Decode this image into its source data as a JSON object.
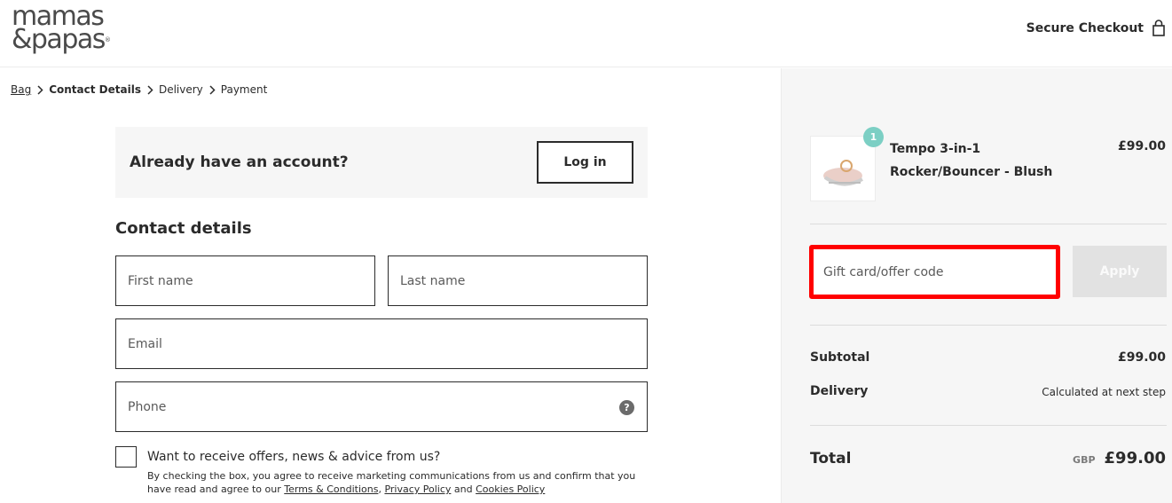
{
  "header": {
    "logo_line1": "mamas",
    "logo_line2": "&papas",
    "logo_mark": "®",
    "secure_checkout": "Secure Checkout",
    "lock_icon": "padlock-icon"
  },
  "breadcrumb": {
    "items": [
      "Bag",
      "Contact Details",
      "Delivery",
      "Payment"
    ],
    "separator_icon": "chevron-right-icon"
  },
  "account": {
    "prompt": "Already have an account?",
    "login_label": "Log in"
  },
  "contact": {
    "title": "Contact details",
    "first_name_placeholder": "First name",
    "last_name_placeholder": "Last name",
    "email_placeholder": "Email",
    "phone_placeholder": "Phone",
    "help_icon": "question-icon",
    "help_glyph": "?",
    "offers_label": "Want to receive offers, news & advice from us?",
    "disclaimer_prefix": "By checking the box, you agree to receive marketing communications from us and confirm that you have read and agree to our ",
    "terms_link": "Terms & Conditions",
    "comma": ", ",
    "privacy_link": "Privacy Policy",
    "and": " and ",
    "cookies_link": "Cookies Policy"
  },
  "summary": {
    "item": {
      "quantity": "1",
      "name": "Tempo 3-in-1 Rocker/Bouncer - Blush",
      "price": "£99.00"
    },
    "gift_placeholder": "Gift card/offer code",
    "apply_label": "Apply",
    "subtotal_label": "Subtotal",
    "subtotal_value": "£99.00",
    "delivery_label": "Delivery",
    "delivery_value": "Calculated at next step",
    "total_label": "Total",
    "currency": "GBP",
    "total_value": "£99.00"
  },
  "colors": {
    "text": "#2b2b2b",
    "summary_bg": "#f6f6f6",
    "quantity_badge": "#7ccfc4",
    "highlight": "#ff0000",
    "apply_disabled": "#e2e2e2"
  }
}
